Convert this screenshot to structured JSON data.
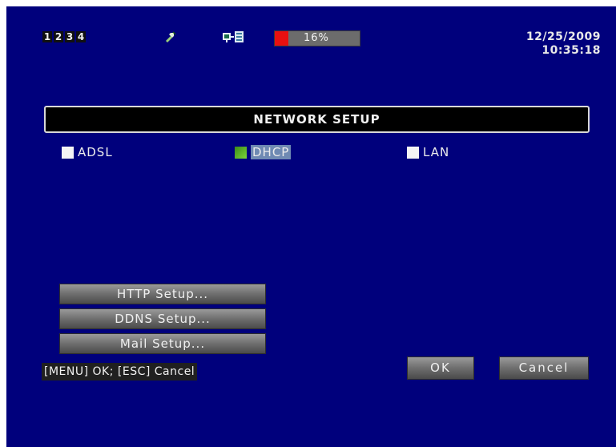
{
  "status_bar": {
    "channels": [
      "1",
      "2",
      "3",
      "4"
    ],
    "icons": [
      "tool-icon",
      "network-icon"
    ],
    "hdd_usage_label": "16%",
    "hdd_usage_fraction": 0.16,
    "date": "12/25/2009",
    "time": "10:35:18"
  },
  "dialog": {
    "title": "NETWORK SETUP",
    "options": [
      {
        "label": "ADSL",
        "checked": false,
        "selected": false
      },
      {
        "label": "DHCP",
        "checked": true,
        "selected": true
      },
      {
        "label": "LAN",
        "checked": false,
        "selected": false
      }
    ],
    "buttons": {
      "http": "HTTP Setup...",
      "ddns": "DDNS Setup...",
      "mail": "Mail Setup..."
    },
    "hint": "[MENU] OK; [ESC] Cancel",
    "ok": "OK",
    "cancel": "Cancel"
  },
  "colors": {
    "background": "#00007c",
    "hdd_fill": "#e81010",
    "checkbox_checked": "#5cb82a",
    "selection_highlight": "#6f8ab3"
  }
}
